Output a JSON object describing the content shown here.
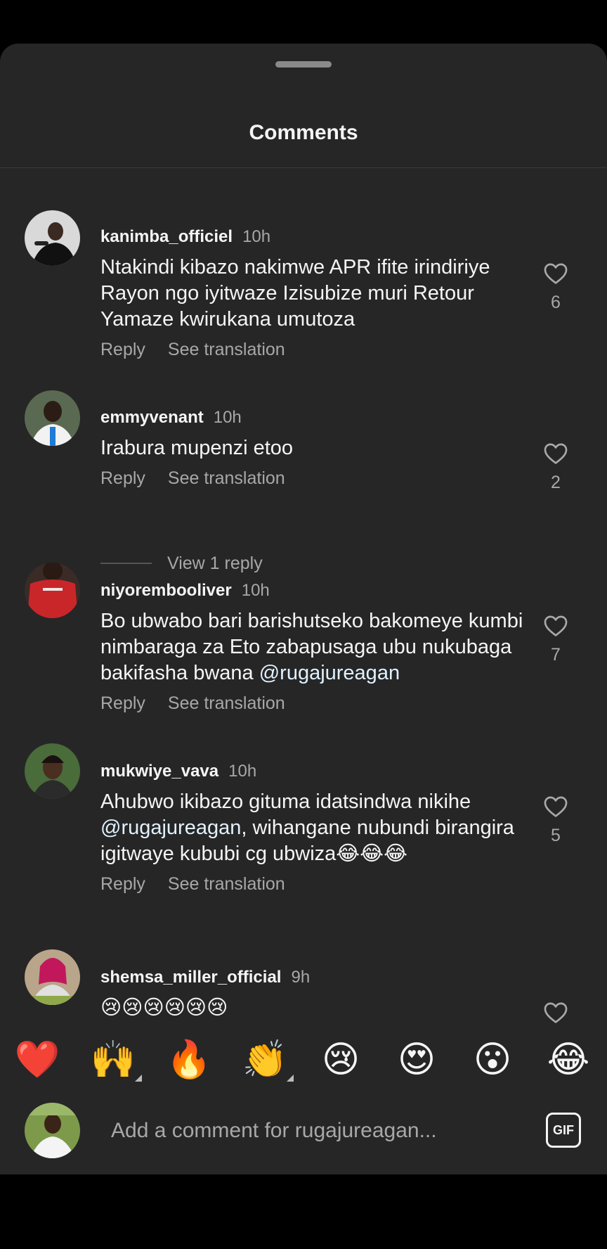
{
  "sheet": {
    "title": "Comments"
  },
  "common": {
    "reply_label": "Reply",
    "see_translation_label": "See translation"
  },
  "comments": [
    {
      "username": "kanimba_officiel",
      "time": "10h",
      "text_parts": [
        "Ntakindi kibazo nakimwe APR ifite irindiriye Rayon ngo iyitwaze Izisubize muri Retour Yamaze kwirukana umutoza"
      ],
      "likes": "6"
    },
    {
      "username": "emmyvenant",
      "time": "10h",
      "text_parts": [
        "Irabura mupenzi etoo"
      ],
      "likes": "2",
      "view_replies": "View 1 reply"
    },
    {
      "username": "niyorembooliver",
      "time": "10h",
      "text_before": "Bo ubwabo bari barishutseko bakomeye kumbi nimbaraga za Eto zabapusaga ubu nukubaga bakifasha bwana ",
      "mention": "@rugajureagan",
      "likes": "7"
    },
    {
      "username": "mukwiye_vava",
      "time": "10h",
      "text_before": "Ahubwo ikibazo gituma idatsindwa nikihe ",
      "mention": "@rugajureagan",
      "text_after": ", wihangane nubundi birangira igitwaye kububi cg ubwiza😂😂😂",
      "likes": "5"
    },
    {
      "username": "shemsa_miller_official",
      "time": "9h",
      "text_parts": [
        "😢😢😢😢😢😢"
      ],
      "likes": ""
    }
  ],
  "reactions": [
    "❤️",
    "🙌",
    "🔥",
    "👏",
    "😢",
    "😍",
    "😮",
    "😂"
  ],
  "input": {
    "placeholder": "Add a comment for rugajureagan...",
    "gif_label": "GIF"
  },
  "colors": {
    "background": "#000000",
    "sheet": "#262626",
    "secondary_text": "#a8a8a8",
    "mention": "#e0f1ff"
  }
}
